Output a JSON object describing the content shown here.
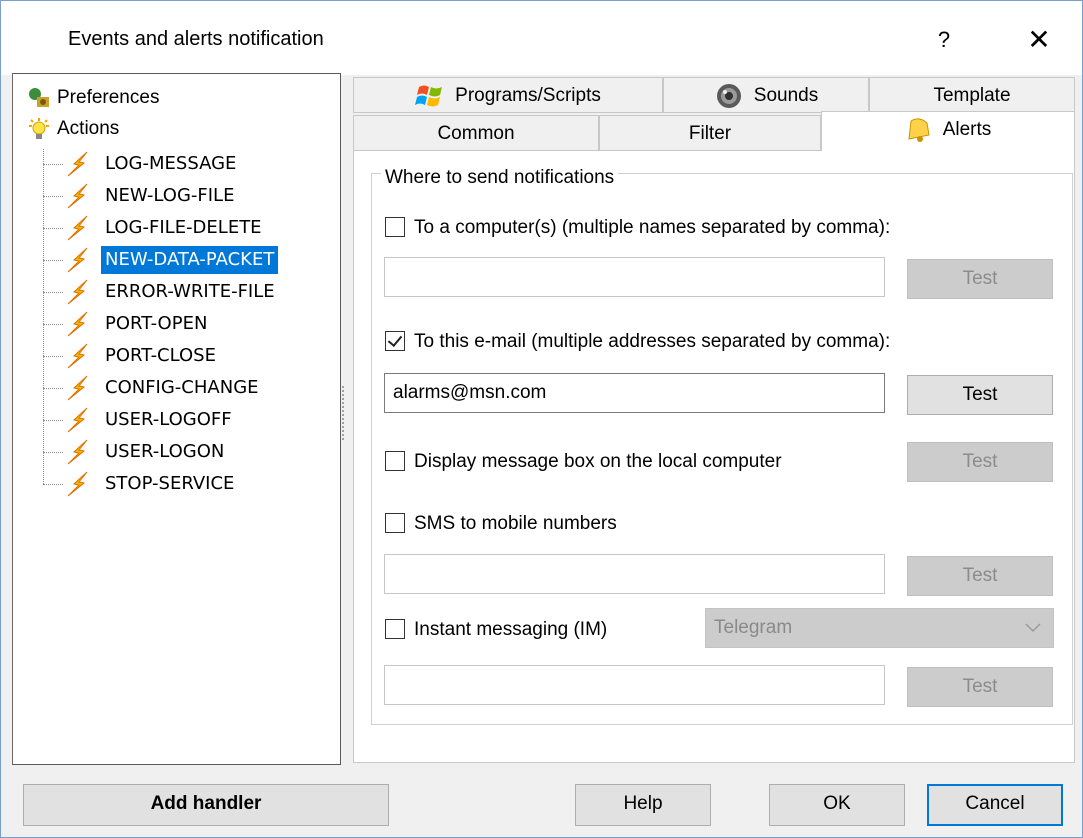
{
  "window": {
    "title": "Events and alerts notification",
    "help_glyph": "?",
    "close_glyph": "✕"
  },
  "tree": {
    "roots": [
      {
        "label": "Preferences",
        "icon": "preferences-icon"
      },
      {
        "label": "Actions",
        "icon": "lightbulb-icon"
      }
    ],
    "actions": [
      {
        "label": "LOG-MESSAGE",
        "selected": false
      },
      {
        "label": "NEW-LOG-FILE",
        "selected": false
      },
      {
        "label": "LOG-FILE-DELETE",
        "selected": false
      },
      {
        "label": "NEW-DATA-PACKET",
        "selected": true
      },
      {
        "label": "ERROR-WRITE-FILE",
        "selected": false
      },
      {
        "label": "PORT-OPEN",
        "selected": false
      },
      {
        "label": "PORT-CLOSE",
        "selected": false
      },
      {
        "label": "CONFIG-CHANGE",
        "selected": false
      },
      {
        "label": "USER-LOGOFF",
        "selected": false
      },
      {
        "label": "USER-LOGON",
        "selected": false
      },
      {
        "label": "STOP-SERVICE",
        "selected": false
      }
    ]
  },
  "tabs": {
    "row1": [
      {
        "label": "Programs/Scripts",
        "icon": "windows-logo-icon"
      },
      {
        "label": "Sounds",
        "icon": "speaker-icon"
      },
      {
        "label": "Template",
        "icon": ""
      }
    ],
    "row2": [
      {
        "label": "Common",
        "icon": ""
      },
      {
        "label": "Filter",
        "icon": ""
      },
      {
        "label": "Alerts",
        "icon": "bell-icon",
        "active": true
      }
    ]
  },
  "alerts": {
    "group_label": "Where to send notifications",
    "computers": {
      "label": "To a computer(s) (multiple names separated by comma):",
      "checked": false,
      "value": "",
      "test_label": "Test",
      "test_enabled": false
    },
    "email": {
      "label": "To this e-mail (multiple addresses separated by comma):",
      "checked": true,
      "value": "alarms@msn.com",
      "test_label": "Test",
      "test_enabled": true
    },
    "msgbox": {
      "label": "Display message box on the local computer",
      "checked": false,
      "test_label": "Test",
      "test_enabled": false
    },
    "sms": {
      "label": "SMS to mobile numbers",
      "checked": false,
      "value": "",
      "test_label": "Test",
      "test_enabled": false
    },
    "im": {
      "label": "Instant messaging (IM)",
      "checked": false,
      "service": "Telegram",
      "value": "",
      "test_label": "Test",
      "test_enabled": false
    }
  },
  "footer": {
    "add_handler": "Add handler",
    "help": "Help",
    "ok": "OK",
    "cancel": "Cancel"
  },
  "colors": {
    "selection": "#0078d7",
    "bolt": "#f5b800",
    "disabled_button": "#cccccc"
  }
}
